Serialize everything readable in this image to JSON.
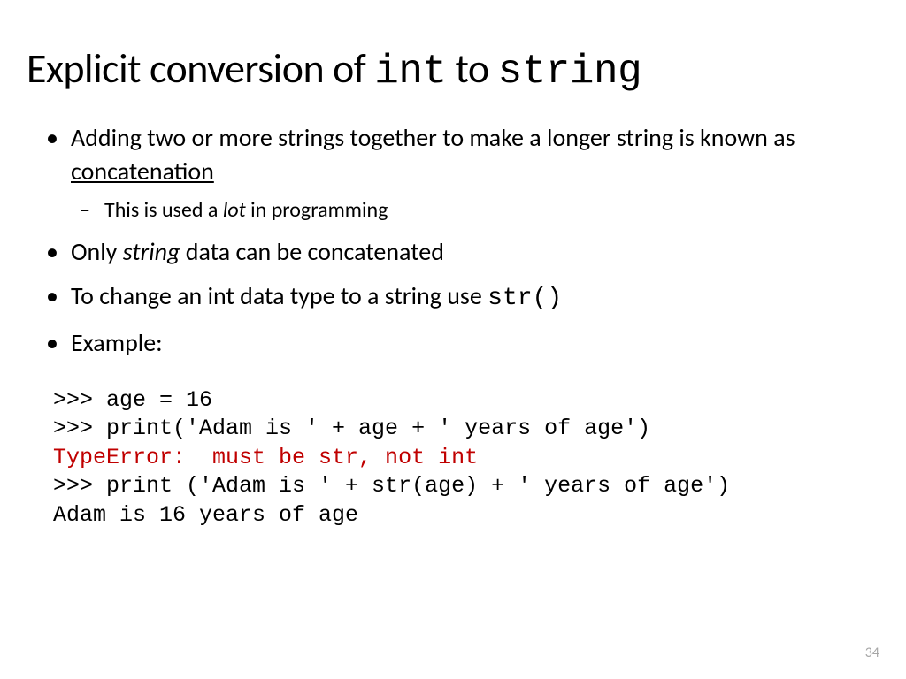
{
  "title": {
    "part1": "Explicit conversion of ",
    "code1": "int",
    "part2": " to ",
    "code2": "string"
  },
  "bullets": {
    "b1_part1": "Adding two or more strings together to make a longer string is known as ",
    "b1_underline": "concatenation",
    "b1_sub_part1": "This is used a ",
    "b1_sub_italic": "lot",
    "b1_sub_part2": " in programming",
    "b2_part1": "Only ",
    "b2_italic": "string",
    "b2_part2": " data can be concatenated",
    "b3_part1": "To change an int data type to a string use ",
    "b3_code": "str()",
    "b4": "Example:"
  },
  "code": {
    "line1": ">>> age = 16",
    "line2": ">>> print('Adam is ' + age + ' years of age')",
    "line3": "TypeError:  must be str, not int",
    "line4": ">>> print ('Adam is ' + str(age) + ' years of age')",
    "line5": "Adam is 16 years of age"
  },
  "page_number": "34"
}
